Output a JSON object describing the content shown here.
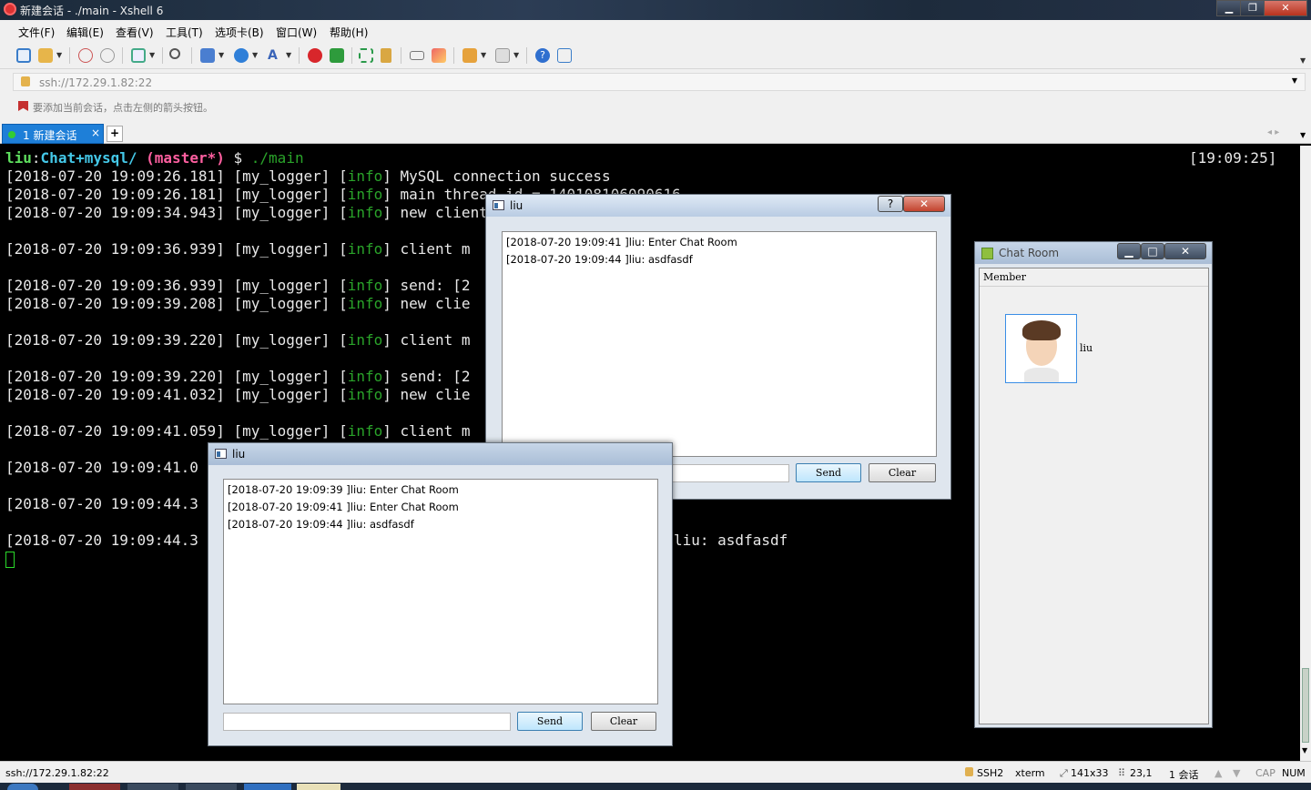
{
  "window": {
    "title": "新建会话 - ./main - Xshell 6"
  },
  "menu": [
    "文件(F)",
    "编辑(E)",
    "查看(V)",
    "工具(T)",
    "选项卡(B)",
    "窗口(W)",
    "帮助(H)"
  ],
  "address": {
    "value": "ssh://172.29.1.82:22"
  },
  "hint": "要添加当前会话，点击左侧的箭头按钮。",
  "tabs": [
    {
      "label": "1 新建会话",
      "close": "×"
    }
  ],
  "add_tab": "+",
  "terminal": {
    "prompt_user": "liu",
    "prompt_colon": ":",
    "prompt_path": "Chat+mysql/",
    "prompt_branch": "(master*)",
    "prompt_dollar": "$",
    "prompt_cmd": "./main",
    "clock": "[19:09:25]",
    "lines": [
      {
        "ts": "[2018-07-20 19:09:26.181]",
        "msg": "MySQL connection success"
      },
      {
        "ts": "[2018-07-20 19:09:26.181]",
        "msg": "main thread id = 140108106090616"
      },
      {
        "ts": "[2018-07-20 19:09:34.943]",
        "msg": "new client"
      },
      {
        "ts": "[2018-07-20 19:09:36.939]",
        "msg": "client m"
      },
      {
        "ts": "[2018-07-20 19:09:36.939]",
        "msg": "send: [2"
      },
      {
        "ts": "[2018-07-20 19:09:39.208]",
        "msg": "new clie"
      },
      {
        "ts": "[2018-07-20 19:09:39.220]",
        "msg": "client m"
      },
      {
        "ts": "[2018-07-20 19:09:39.220]",
        "msg": "send: [2"
      },
      {
        "ts": "[2018-07-20 19:09:41.032]",
        "msg": "new clie"
      },
      {
        "ts": "[2018-07-20 19:09:41.059]",
        "msg": "client m"
      }
    ],
    "partial_lines": [
      "[2018-07-20 19:09:41.0",
      "[2018-07-20 19:09:44.3",
      "[2018-07-20 19:09:44.3"
    ],
    "logger": "[my_logger]",
    "level": "info",
    "tail_text": "liu: asdfasdf"
  },
  "chat_window_1": {
    "title": "liu",
    "messages": [
      "[2018-07-20 19:09:41 ]liu: Enter Chat Room",
      "[2018-07-20 19:09:44 ]liu: asdfasdf"
    ],
    "send": "Send",
    "clear": "Clear",
    "help": "?",
    "close": "✕"
  },
  "chat_window_2": {
    "title": "liu",
    "messages": [
      "[2018-07-20 19:09:39 ]liu: Enter Chat Room",
      "[2018-07-20 19:09:41 ]liu: Enter Chat Room",
      "[2018-07-20 19:09:44 ]liu: asdfasdf"
    ],
    "send": "Send",
    "clear": "Clear"
  },
  "chat_room": {
    "title": "Chat Room",
    "header": "Member",
    "members": [
      {
        "name": "liu"
      }
    ],
    "min": "▁",
    "max": "□",
    "close": "✕"
  },
  "status": {
    "left": "ssh://172.29.1.82:22",
    "protocol": "SSH2",
    "term": "xterm",
    "size": "141x33",
    "pos": "23,1",
    "sessions": "1 会话",
    "cap": "CAP",
    "num": "NUM"
  }
}
